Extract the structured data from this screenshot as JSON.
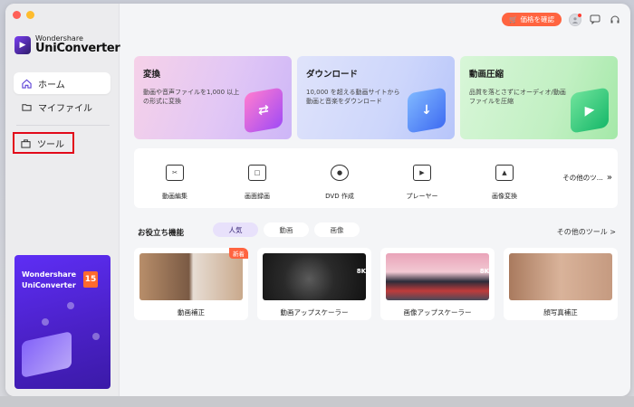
{
  "app": {
    "logo_small": "Wondershare",
    "logo_big": "UniConverter"
  },
  "sidebar": {
    "items": [
      {
        "label": "ホーム",
        "icon": "home-icon"
      },
      {
        "label": "マイファイル",
        "icon": "folder-icon"
      },
      {
        "label": "ツール",
        "icon": "toolbox-icon"
      }
    ],
    "promo": {
      "line1": "Wondershare",
      "line2": "UniConverter",
      "badge": "15"
    }
  },
  "topbar": {
    "price_label": "価格を確認"
  },
  "features": [
    {
      "title": "変換",
      "desc": "動画や音声ファイルを1,000 以上の形式に変換"
    },
    {
      "title": "ダウンロード",
      "desc": "10,000 を超える動画サイトから動画と音楽をダウンロード"
    },
    {
      "title": "動画圧縮",
      "desc": "品質を落とさずにオーディオ/動画ファイルを圧縮"
    }
  ],
  "tools": [
    {
      "label": "動画編集",
      "icon": "video-edit-icon"
    },
    {
      "label": "画面録画",
      "icon": "screen-record-icon"
    },
    {
      "label": "DVD 作成",
      "icon": "dvd-icon"
    },
    {
      "label": "プレーヤー",
      "icon": "player-icon"
    },
    {
      "label": "画像変換",
      "icon": "image-convert-icon"
    }
  ],
  "tools_more": "その他のツ...",
  "helpful": {
    "title": "お役立ち機能",
    "chips": [
      "人気",
      "動画",
      "画像"
    ],
    "more": "その他のツール >",
    "items": [
      {
        "label": "動画補正",
        "badge": "新着"
      },
      {
        "label": "動画アップスケーラー",
        "res": "8K"
      },
      {
        "label": "画像アップスケーラー",
        "res": "8K"
      },
      {
        "label": "顔写真補正"
      }
    ]
  },
  "colors": {
    "accent": "#ff6440",
    "highlight_box": "#e20a1a",
    "active_chip": "#e8e1fb"
  }
}
